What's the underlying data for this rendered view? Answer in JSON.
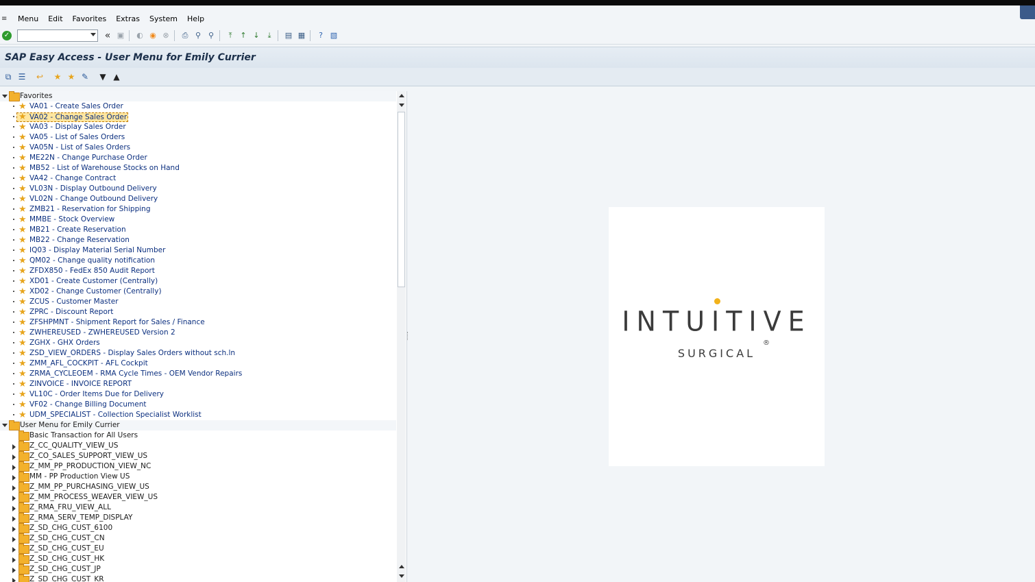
{
  "menubar": {
    "items": [
      "Menu",
      "Edit",
      "Favorites",
      "Extras",
      "System",
      "Help"
    ]
  },
  "toolbar": {
    "command_field_value": "",
    "icons": [
      "enter-check-icon",
      "back-double-arrow-icon",
      "save-icon",
      "back-icon",
      "exit-icon",
      "cancel-icon",
      "print-icon",
      "find-icon",
      "find-next-icon",
      "first-page-icon",
      "previous-page-icon",
      "next-page-icon",
      "last-page-icon",
      "create-session-icon",
      "shortcut-icon",
      "help-icon",
      "layout-menu-icon"
    ]
  },
  "title": "SAP Easy Access  -  User Menu for Emily Currier",
  "app_toolbar": {
    "icons": [
      "other-menu-icon",
      "sap-menu-icon",
      "back-arrow-icon",
      "add-favorite-icon",
      "remove-favorite-icon",
      "change-favorite-icon",
      "expand-down-icon",
      "collapse-up-icon"
    ]
  },
  "tree": {
    "favorites_label": "Favorites",
    "favorites": [
      "VA01 - Create Sales Order",
      "VA02 - Change Sales Order",
      "VA03 - Display Sales Order",
      "VA05 - List of Sales Orders",
      "VA05N - List of Sales Orders",
      "ME22N - Change Purchase Order",
      "MB52 - List of Warehouse Stocks on Hand",
      "VA42 - Change Contract",
      "VL03N - Display Outbound Delivery",
      "VL02N - Change Outbound Delivery",
      "ZMB21 - Reservation for Shipping",
      "MMBE - Stock Overview",
      "MB21 - Create Reservation",
      "MB22 - Change Reservation",
      "IQ03 - Display Material Serial Number",
      "QM02 - Change quality notification",
      "ZFDX850 - FedEx 850 Audit Report",
      "XD01 - Create Customer (Centrally)",
      "XD02 - Change Customer (Centrally)",
      "ZCUS - Customer Master",
      "ZPRC - Discount Report",
      "ZFSHPMNT - Shipment Report for Sales / Finance",
      "ZWHEREUSED - ZWHEREUSED Version 2",
      "ZGHX - GHX Orders",
      "ZSD_VIEW_ORDERS - Display Sales Orders without sch.ln",
      "ZMM_AFL_COCKPIT - AFL Cockpit",
      "ZRMA_CYCLEOEM - RMA Cycle Times - OEM Vendor Repairs",
      "ZINVOICE - INVOICE REPORT",
      "VL10C - Order Items Due for Delivery",
      "VF02 - Change Billing Document",
      "UDM_SPECIALIST - Collection Specialist Worklist"
    ],
    "selected_index": 1,
    "user_menu_label": "User Menu for Emily Currier",
    "user_menu": [
      "Basic Transaction for All Users",
      "Z_CC_QUALITY_VIEW_US",
      "Z_CO_SALES_SUPPORT_VIEW_US",
      "Z_MM_PP_PRODUCTION_VIEW_NC",
      "MM - PP Production View US",
      "Z_MM_PP_PURCHASING_VIEW_US",
      "Z_MM_PROCESS_WEAVER_VIEW_US",
      "Z_RMA_FRU_VIEW_ALL",
      "Z_RMA_SERV_TEMP_DISPLAY",
      "Z_SD_CHG_CUST_6100",
      "Z_SD_CHG_CUST_CN",
      "Z_SD_CHG_CUST_EU",
      "Z_SD_CHG_CUST_HK",
      "Z_SD_CHG_CUST_JP",
      "Z_SD_CHG_CUST_KR"
    ]
  },
  "logo": {
    "main": "INTUITIVE",
    "sub": "SURGICAL",
    "reg": "®"
  }
}
